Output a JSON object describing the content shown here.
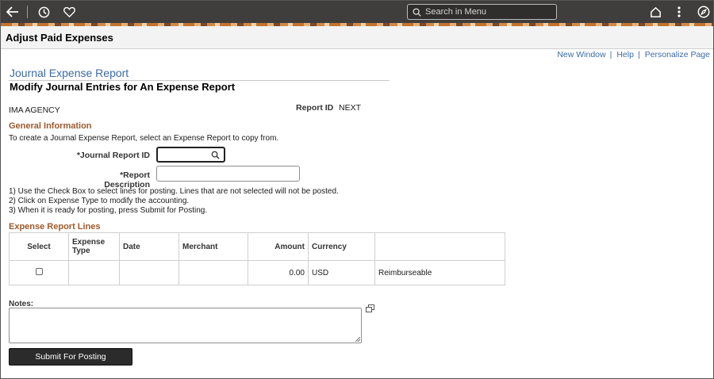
{
  "topbar": {
    "back_icon": "back-arrow-icon",
    "history_icon": "clock-icon",
    "favorites_icon": "heart-icon",
    "search_placeholder": "Search in Menu",
    "home_icon": "home-icon",
    "actions_icon": "kebab-menu-icon",
    "navbar_icon": "compass-icon"
  },
  "page": {
    "title": "Adjust Paid Expenses"
  },
  "links": {
    "new_window": "New Window",
    "help": "Help",
    "personalize": "Personalize Page",
    "separator": "|"
  },
  "header": {
    "subtitle": "Journal Expense Report",
    "heading": "Modify Journal Entries for An Expense Report",
    "agency": "IMA AGENCY",
    "report_id_label": "Report ID",
    "report_id_value": "NEXT"
  },
  "general_info": {
    "title": "General Information",
    "instruction": "To create a Journal Expense Report, select an Expense Report to copy from.",
    "journal_report_id_label": "*Journal Report ID",
    "journal_report_id_value": "",
    "report_description_label": "*Report Description",
    "report_description_value": ""
  },
  "instructions": [
    "1) Use the Check Box to select lines for posting. Lines that are not selected will not be posted.",
    "2) Click on Expense Type to modify the accounting.",
    "3) When it is ready for posting, press Submit for Posting."
  ],
  "lines": {
    "title": "Expense Report Lines",
    "columns": [
      "Select",
      "Expense Type",
      "Date",
      "Merchant",
      "Amount",
      "Currency",
      ""
    ],
    "rows": [
      {
        "selected": false,
        "expense_type": "",
        "date": "",
        "merchant": "",
        "amount": "0.00",
        "currency": "USD",
        "type": "Reimburseable"
      }
    ]
  },
  "notes": {
    "label": "Notes:",
    "value": ""
  },
  "submit_label": "Submit For Posting"
}
